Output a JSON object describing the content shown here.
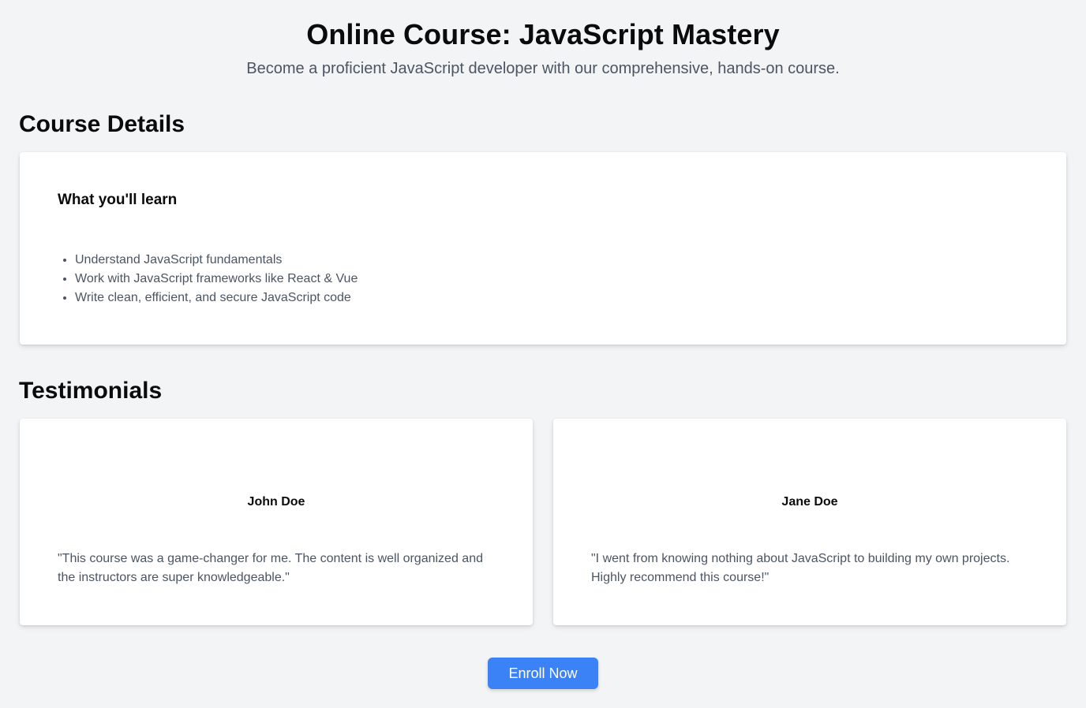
{
  "header": {
    "title": "Online Course: JavaScript Mastery",
    "subtitle": "Become a proficient JavaScript developer with our comprehensive, hands-on course."
  },
  "course_details": {
    "heading": "Course Details",
    "subheading": "What you'll learn",
    "items": [
      "Understand JavaScript fundamentals",
      "Work with JavaScript frameworks like React & Vue",
      "Write clean, efficient, and secure JavaScript code"
    ]
  },
  "testimonials": {
    "heading": "Testimonials",
    "items": [
      {
        "name": "John Doe",
        "quote": "\"This course was a game-changer for me. The content is well organized and the instructors are super knowledgeable.\""
      },
      {
        "name": "Jane Doe",
        "quote": "\"I went from knowing nothing about JavaScript to building my own projects. Highly recommend this course!\""
      }
    ]
  },
  "enroll": {
    "label": "Enroll Now"
  },
  "colors": {
    "background": "#f3f4f6",
    "card": "#ffffff",
    "muted_text": "#4b5563",
    "primary_button": "#3b82f6"
  }
}
